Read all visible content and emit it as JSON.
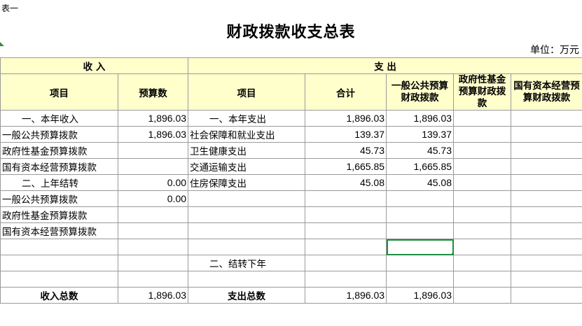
{
  "sheet_label": "表一",
  "title": "财政拨款收支总表",
  "unit": "单位：万元",
  "headers": {
    "income": "收  入",
    "expense": "支  出",
    "item": "项目",
    "budget": "预算数",
    "item2": "项目",
    "total": "合计",
    "general": "一般公共预算财政拨款",
    "fund": "政府性基金预算财政拨款",
    "soe": "国有资本经营预算财政拨款"
  },
  "rows": [
    {
      "in_item": "一、本年收入",
      "in_val": "1,896.03",
      "ex_item": "一、本年支出",
      "ex_total": "1,896.03",
      "ex_general": "1,896.03",
      "ex_fund": "",
      "ex_soe": ""
    },
    {
      "in_item": "一般公共预算拨款",
      "in_val": "1,896.03",
      "ex_item": "社会保障和就业支出",
      "ex_total": "139.37",
      "ex_general": "139.37",
      "ex_fund": "",
      "ex_soe": ""
    },
    {
      "in_item": "政府性基金预算拨款",
      "in_val": "",
      "ex_item": "卫生健康支出",
      "ex_total": "45.73",
      "ex_general": "45.73",
      "ex_fund": "",
      "ex_soe": ""
    },
    {
      "in_item": "国有资本经营预算拨款",
      "in_val": "",
      "ex_item": "交通运输支出",
      "ex_total": "1,665.85",
      "ex_general": "1,665.85",
      "ex_fund": "",
      "ex_soe": ""
    },
    {
      "in_item": "二、上年结转",
      "in_val": "0.00",
      "ex_item": "住房保障支出",
      "ex_total": "45.08",
      "ex_general": "45.08",
      "ex_fund": "",
      "ex_soe": ""
    },
    {
      "in_item": "一般公共预算拨款",
      "in_val": "0.00",
      "ex_item": "",
      "ex_total": "",
      "ex_general": "",
      "ex_fund": "",
      "ex_soe": ""
    },
    {
      "in_item": "政府性基金预算拨款",
      "in_val": "",
      "ex_item": "",
      "ex_total": "",
      "ex_general": "",
      "ex_fund": "",
      "ex_soe": ""
    },
    {
      "in_item": "国有资本经营预算拨款",
      "in_val": "",
      "ex_item": "",
      "ex_total": "",
      "ex_general": "",
      "ex_fund": "",
      "ex_soe": ""
    },
    {
      "in_item": "",
      "in_val": "",
      "ex_item": "",
      "ex_total": "",
      "ex_general": "",
      "ex_fund": "",
      "ex_soe": ""
    },
    {
      "in_item": "",
      "in_val": "",
      "ex_item": "二、结转下年",
      "ex_total": "",
      "ex_general": "",
      "ex_fund": "",
      "ex_soe": ""
    },
    {
      "in_item": "",
      "in_val": "",
      "ex_item": "",
      "ex_total": "",
      "ex_general": "",
      "ex_fund": "",
      "ex_soe": ""
    }
  ],
  "totals": {
    "in_label": "收入总数",
    "in_val": "1,896.03",
    "ex_label": "支出总数",
    "ex_total": "1,896.03",
    "ex_general": "1,896.03",
    "ex_fund": "",
    "ex_soe": ""
  },
  "colors": {
    "header_bg": "#ffffcc",
    "selection": "#1e8e3e",
    "grid": "#9a9a9a"
  }
}
